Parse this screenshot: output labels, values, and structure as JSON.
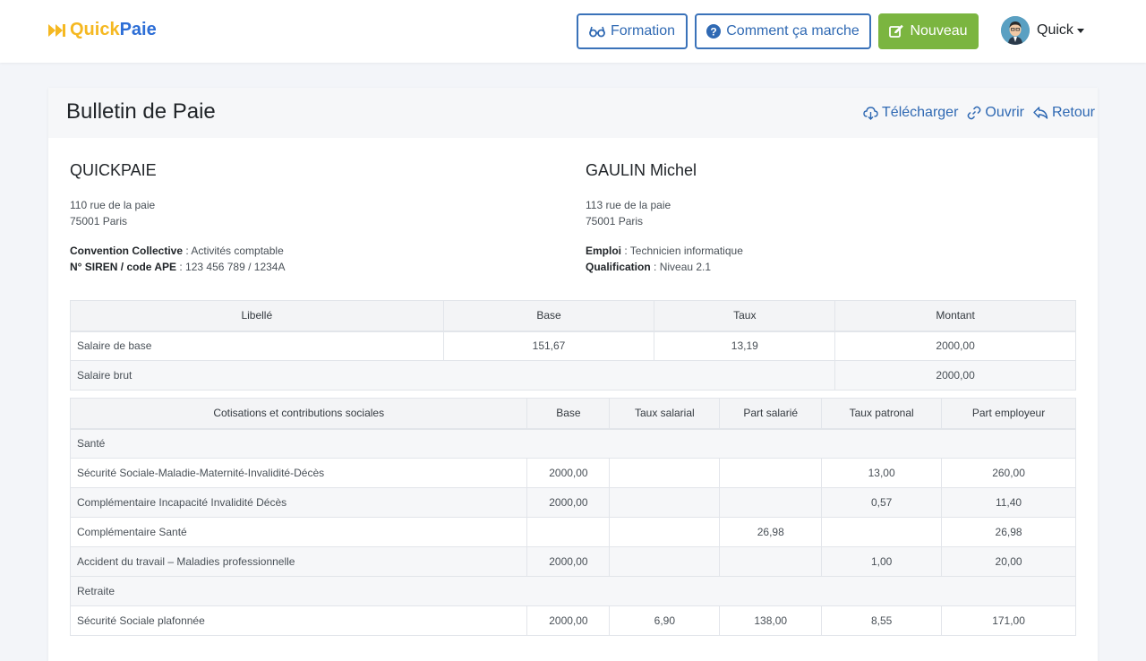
{
  "brand": {
    "part1": "Quick",
    "part2": "Paie"
  },
  "nav": {
    "formation": "Formation",
    "comment": "Comment ça marche",
    "nouveau": "Nouveau",
    "user": "Quick"
  },
  "card": {
    "title": "Bulletin de Paie",
    "actions": {
      "telecharger": "Télécharger",
      "ouvrir": "Ouvrir",
      "retour": "Retour"
    }
  },
  "company": {
    "name": "QUICKPAIE",
    "addr1": "110 rue de la paie",
    "addr2": "75001 Paris",
    "conv_label": "Convention Collective",
    "conv_value": " : Activités comptable",
    "siren_label": "N° SIREN / code APE",
    "siren_value": " : 123 456 789 / 1234A"
  },
  "employee": {
    "name": "GAULIN Michel",
    "addr1": "113 rue de la paie",
    "addr2": "75001 Paris",
    "emploi_label": "Emploi",
    "emploi_value": " : Technicien informatique",
    "qualif_label": "Qualification",
    "qualif_value": " : Niveau 2.1"
  },
  "salary": {
    "headers": [
      "Libellé",
      "Base",
      "Taux",
      "Montant"
    ],
    "base_row": [
      "Salaire de base",
      "151,67",
      "13,19",
      "2000,00"
    ],
    "brut_row": [
      "Salaire brut",
      "2000,00"
    ]
  },
  "cotisations": {
    "headers": [
      "Cotisations et contributions sociales",
      "Base",
      "Taux salarial",
      "Part salarié",
      "Taux patronal",
      "Part employeur"
    ],
    "sections": [
      "Santé",
      "Retraite"
    ],
    "rows": [
      [
        "Sécurité Sociale-Maladie-Maternité-Invalidité-Décès",
        "2000,00",
        "",
        "",
        "13,00",
        "260,00"
      ],
      [
        "Complémentaire Incapacité Invalidité Décès",
        "2000,00",
        "",
        "",
        "0,57",
        "11,40"
      ],
      [
        "Complémentaire Santé",
        "",
        "",
        "26,98",
        "",
        "26,98"
      ],
      [
        "Accident du travail – Maladies professionnelle",
        "2000,00",
        "",
        "",
        "1,00",
        "20,00"
      ],
      [
        "Sécurité Sociale plafonnée",
        "2000,00",
        "6,90",
        "138,00",
        "8,55",
        "171,00"
      ]
    ]
  },
  "colors": {
    "brand_yellow": "#f5b821",
    "brand_blue": "#2d6ed6",
    "outline_blue": "#2f69b3",
    "green": "#7bb540"
  }
}
